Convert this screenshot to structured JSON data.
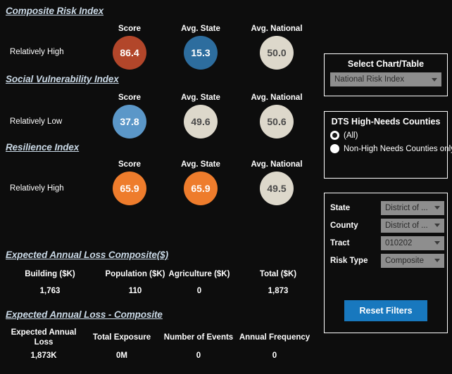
{
  "indices": [
    {
      "heading": "Composite Risk Index",
      "rating": "Relatively High",
      "columns": [
        "Score",
        "Avg. State",
        "Avg. National"
      ],
      "score": {
        "value": "86.4",
        "color": "#b2462a",
        "text_color": "#ffffff"
      },
      "state": {
        "value": "15.3",
        "color": "#2d6d9e",
        "text_color": "#ffffff"
      },
      "national": {
        "value": "50.0",
        "color": "#ddd8cb",
        "text_color": "#4a4a4a"
      }
    },
    {
      "heading": "Social Vulnerability Index",
      "rating": "Relatively Low",
      "columns": [
        "Score",
        "Avg. State",
        "Avg. National"
      ],
      "score": {
        "value": "37.8",
        "color": "#5b97c8",
        "text_color": "#ffffff"
      },
      "state": {
        "value": "49.6",
        "color": "#ddd8cb",
        "text_color": "#4a4a4a"
      },
      "national": {
        "value": "50.6",
        "color": "#ddd8cb",
        "text_color": "#4a4a4a"
      }
    },
    {
      "heading": "Resilience Index",
      "rating": "Relatively High",
      "columns": [
        "Score",
        "Avg. State",
        "Avg. National"
      ],
      "score": {
        "value": "65.9",
        "color": "#ee7c2c",
        "text_color": "#ffffff"
      },
      "state": {
        "value": "65.9",
        "color": "#ee7c2c",
        "text_color": "#ffffff"
      },
      "national": {
        "value": "49.5",
        "color": "#ddd8cb",
        "text_color": "#4a4a4a"
      }
    }
  ],
  "loss_composite": {
    "heading": "Expected Annual Loss Composite($)",
    "headers": [
      "Building ($K)",
      "Population ($K)",
      "Agriculture ($K)",
      "Total ($K)"
    ],
    "values": [
      "1,763",
      "110",
      "0",
      "1,873"
    ]
  },
  "loss_detail": {
    "heading": "Expected Annual Loss - Composite",
    "headers": [
      "Expected Annual Loss",
      "Total Exposure",
      "Number of Events",
      "Annual Frequency"
    ],
    "values": [
      "1,873K",
      "0M",
      "0",
      "0"
    ]
  },
  "chart_select": {
    "title": "Select Chart/Table",
    "selected": "National Risk Index"
  },
  "high_needs": {
    "title": "DTS High-Needs Counties",
    "options": [
      {
        "label": "(All)",
        "checked": true
      },
      {
        "label": "Non-High Needs Counties only",
        "checked": false
      }
    ]
  },
  "filters": {
    "rows": [
      {
        "label": "State",
        "value": "District of ..."
      },
      {
        "label": "County",
        "value": "District of ..."
      },
      {
        "label": "Tract",
        "value": "010202"
      },
      {
        "label": "Risk Type",
        "value": "Composite"
      }
    ],
    "reset_label": "Reset Filters"
  },
  "colors": {
    "background": "#0d0d0d",
    "heading": "#cad9e6",
    "accent_blue": "#1878be",
    "dropdown_bg": "#8e8e8e"
  }
}
